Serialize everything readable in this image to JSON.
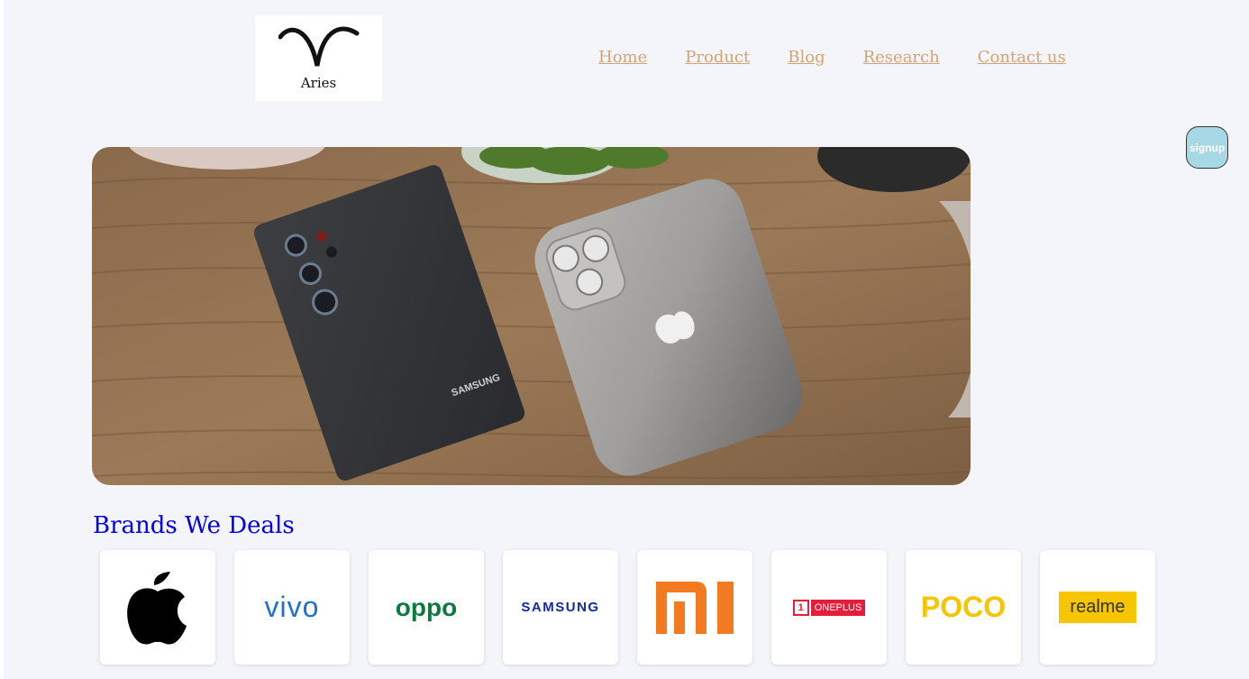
{
  "header": {
    "logo_text": "Aries",
    "nav": [
      {
        "label": "Home"
      },
      {
        "label": "Product"
      },
      {
        "label": "Blog"
      },
      {
        "label": "Research"
      },
      {
        "label": "Contact us"
      }
    ],
    "signup_label": "signup"
  },
  "hero": {
    "image": "hero-phones-image"
  },
  "brands": {
    "title": "Brands We Deals",
    "items": [
      {
        "name": "apple-logo",
        "text": ""
      },
      {
        "name": "vivo-logo",
        "text": "vivo"
      },
      {
        "name": "oppo-logo",
        "text": "oppo"
      },
      {
        "name": "samsung-logo",
        "text": "SAMSUNG"
      },
      {
        "name": "mi-logo",
        "text": ""
      },
      {
        "name": "oneplus-logo",
        "text": "ONEPLUS"
      },
      {
        "name": "poco-logo",
        "text": "POCO"
      },
      {
        "name": "realme-logo",
        "text": "realme"
      }
    ]
  },
  "colors": {
    "page_bg": "#f4f5fb",
    "nav_link": "#d4a373",
    "brands_title": "#0000e6",
    "signup_bg": "#a7d8e6"
  }
}
